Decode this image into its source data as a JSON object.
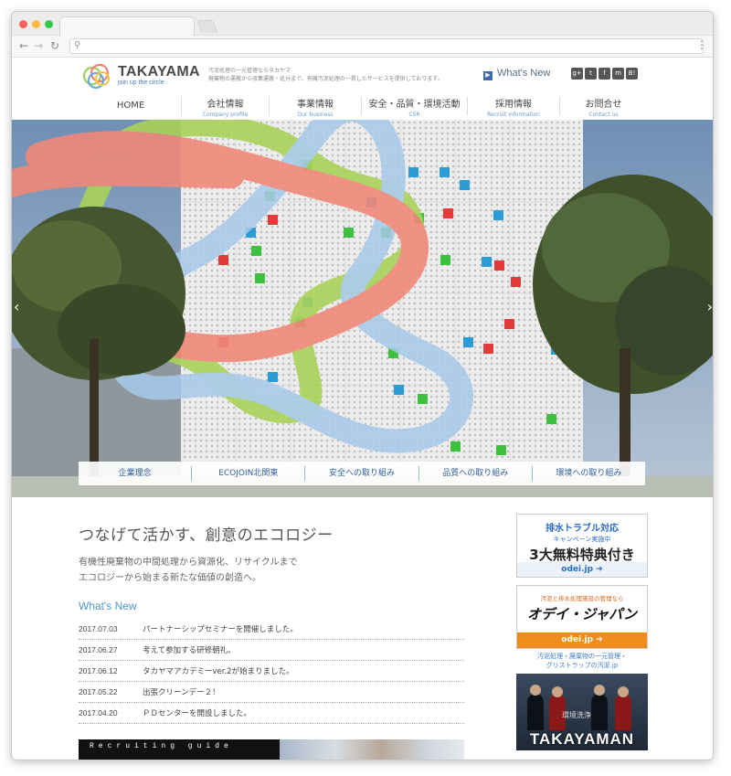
{
  "browser": {
    "url": ""
  },
  "header": {
    "logo_text": "TAKAYAMA",
    "logo_sub": "join up the circle",
    "tagline_1": "汚泥処理の一元管理ならタカヤマ",
    "tagline_2": "廃棄物の運搬から収集運搬・処分まで、有機汚泥処理の一貫したサービスを提供しております。",
    "whats_new": "What's New",
    "social": [
      "g+",
      "t",
      "f",
      "m",
      "B!"
    ]
  },
  "nav": [
    {
      "ja": "HOME",
      "en": ""
    },
    {
      "ja": "会社情報",
      "en": "Company profile"
    },
    {
      "ja": "事業情報",
      "en": "Our business"
    },
    {
      "ja": "安全・品質・環境活動",
      "en": "CSR"
    },
    {
      "ja": "採用情報",
      "en": "Recruit information"
    },
    {
      "ja": "お問合せ",
      "en": "Contact us"
    }
  ],
  "subnav": [
    "企業理念",
    "ECOJOIN北関東",
    "安全への取り組み",
    "品質への取り組み",
    "環境への取り組み"
  ],
  "main": {
    "catch": "つなげて活かす、創意のエコロジー",
    "lead_1": "有機性廃棄物の中間処理から資源化、リサイクルまで",
    "lead_2": "エコロジーから始まる新たな価値の創造へ。",
    "whats_new_title": "What's New",
    "news": [
      {
        "date": "2017.07.03",
        "text": "パートナーシップセミナーを開催しました。"
      },
      {
        "date": "2017.06.27",
        "text": "考えて参加する研修朝礼。"
      },
      {
        "date": "2017.06.12",
        "text": "タカヤマアカデミーver.2が始まりました。"
      },
      {
        "date": "2017.05.22",
        "text": "出張クリーンデー２！"
      },
      {
        "date": "2017.04.20",
        "text": "ＰＤセンターを開設しました。"
      }
    ],
    "recruit_label": "Recruiting guide"
  },
  "side": {
    "b1_title": "排水トラブル対応",
    "b1_sub": "キャンペーン実施中",
    "b1_main": "3大無料特典付き",
    "b1_link": "odei.jp",
    "b2_top": "汚泥と排水処理施設の管理なら",
    "b2_main": "オデイ・ジャパン",
    "b2_link": "odei.jp",
    "b2_caption_1": "汚泥処理・廃棄物の一元管理・",
    "b2_caption_2": "グリストラップの汚泥.jp",
    "b3_small": "環境洗浄",
    "b3_main": "TAKAYAMAN"
  }
}
